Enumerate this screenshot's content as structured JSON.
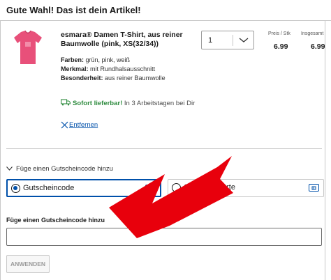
{
  "cart": {
    "heading": "Gute Wahl! Das ist dein Artikel!",
    "product": {
      "title": "esmara® Damen T-Shirt, aus reiner Baumwolle (pink, XS(32/34))",
      "image_icon": "pink-tshirt-image",
      "attributes": [
        {
          "label": "Farben:",
          "value": "grün, pink, weiß"
        },
        {
          "label": "Merkmal:",
          "value": "mit Rundhalsausschnitt"
        },
        {
          "label": "Besonderheit:",
          "value": "aus reiner Baumwolle"
        }
      ],
      "quantity": "1",
      "unit_price_label": "Preis / Stk",
      "unit_price": "6.99",
      "total_label": "Insgesamt",
      "total": "6.99"
    },
    "delivery": {
      "status": "Sofort lieferbar!",
      "detail": " In 3 Arbeitstagen bei Dir"
    },
    "remove_label": "Entfernen"
  },
  "voucher": {
    "toggle_label": "Füge einen Gutscheincode hinzu",
    "options": [
      {
        "label": "Gutscheincode",
        "selected": true
      },
      {
        "label": "Geschenkkarte",
        "selected": false
      }
    ],
    "field_label": "Füge einen Gutscheincode hinzu",
    "input_value": "",
    "apply_label": "ANWENDEN"
  },
  "colors": {
    "accent": "#0050aa",
    "success": "#2e8b3e",
    "annotation_arrow": "#e8000c",
    "product": "#e8507a"
  }
}
